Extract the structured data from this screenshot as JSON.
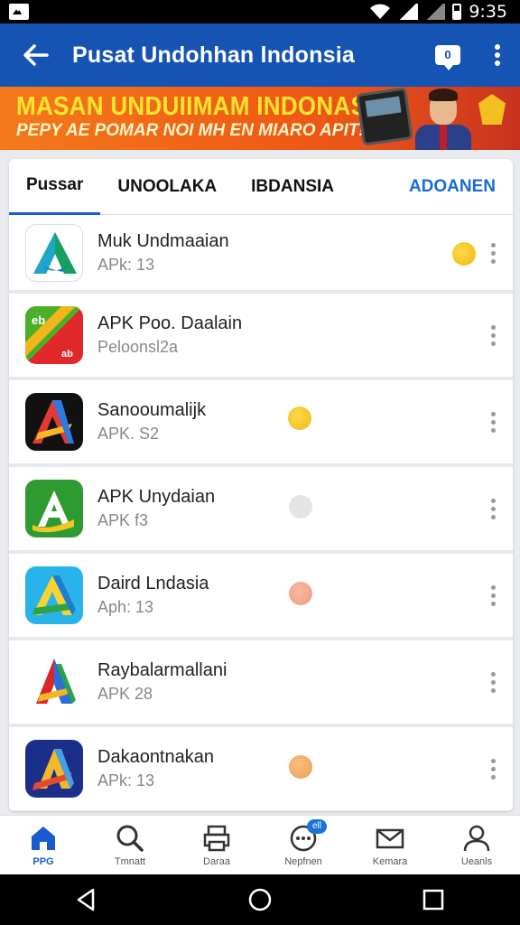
{
  "status_bar": {
    "time": "9:35",
    "icons": [
      "gallery-icon",
      "wifi-icon",
      "signal-icon",
      "battery-icon"
    ]
  },
  "app_bar": {
    "title": "Pusat Undohhan lndonsia",
    "chat_badge": "0",
    "icons": [
      "back-arrow-icon",
      "chat-icon",
      "more-vert-icon"
    ]
  },
  "banner": {
    "line1": "MASAN UNDUIIMAM INDONASIIA",
    "line2": "PEPY AE POMAR NOI MH EN MIARO APIT!"
  },
  "tabs": [
    {
      "label": "Pussar"
    },
    {
      "label": "UNOOLAKA"
    },
    {
      "label": "IBDANSIA"
    },
    {
      "label": "ADOANEN"
    }
  ],
  "apps": [
    {
      "name": "Muk Undmaaian",
      "sub": "APk: 13",
      "dot": "#f5c21b",
      "icon": "teal-green-a-icon"
    },
    {
      "name": "APK Poo. Daalain",
      "sub": "Peloonsl2a",
      "dot": null,
      "icon": "red-green-ab-icon"
    },
    {
      "name": "Sanooumalijk",
      "sub": "APK. S2",
      "dot": "#f1c21e",
      "icon": "black-red-a-icon"
    },
    {
      "name": "APK Unydaian",
      "sub": "APK f3",
      "dot": "#e2e2e2",
      "icon": "green-a-icon"
    },
    {
      "name": "Daird Lndasia",
      "sub": "Aph: 13",
      "dot": "#f3a58c",
      "icon": "cyan-a-icon"
    },
    {
      "name": "Raybalarmallani",
      "sub": "APK 28",
      "dot": null,
      "icon": "rainbow-a-icon"
    },
    {
      "name": "Dakaontnakan",
      "sub": "APk: 13",
      "dot": "#f4a86b",
      "icon": "navy-a-icon"
    }
  ],
  "bottom_nav": [
    {
      "label": "PPG",
      "icon": "home-icon",
      "active": true
    },
    {
      "label": "Tmnatt",
      "icon": "search-icon"
    },
    {
      "label": "Daraa",
      "icon": "printer-icon"
    },
    {
      "label": "Nepfnen",
      "icon": "chat-bubble-icon",
      "badge": "ell"
    },
    {
      "label": "Kemara",
      "icon": "mail-icon"
    },
    {
      "label": "Ueanls",
      "icon": "profile-icon"
    }
  ],
  "colors": {
    "primary": "#1554b2",
    "accent": "#1a6bd4",
    "banner": "#ef5a14"
  }
}
